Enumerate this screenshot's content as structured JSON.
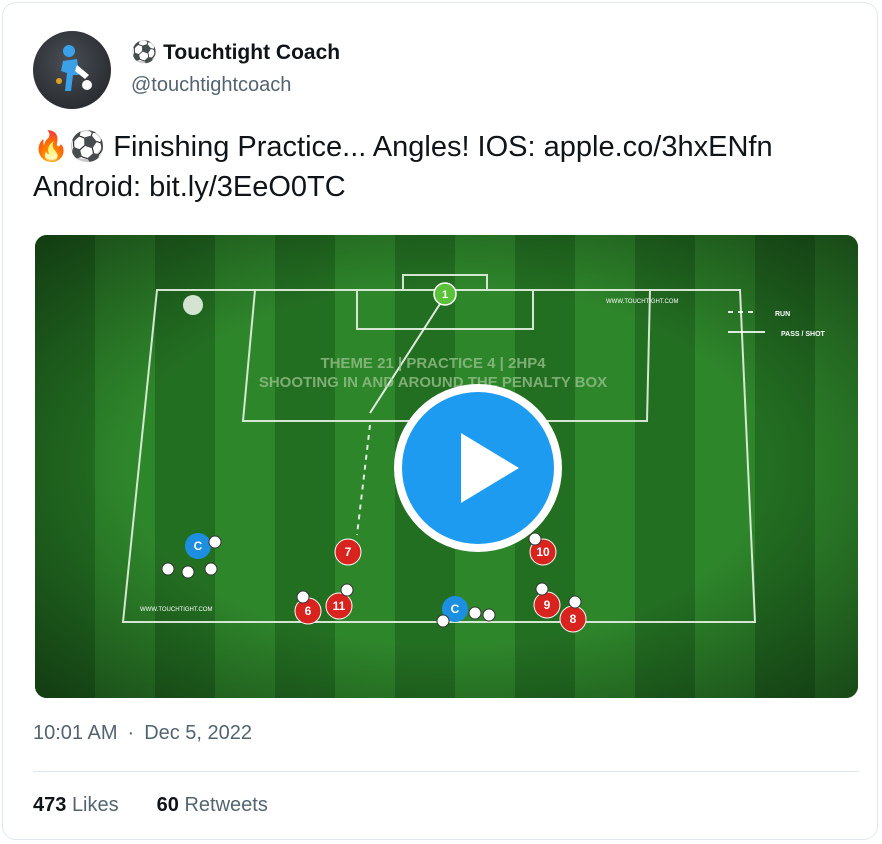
{
  "author": {
    "avatar_icon": "touchtight-logo-icon",
    "name_emoji": "⚽",
    "name": "Touchtight Coach",
    "handle": "@touchtightcoach"
  },
  "tweet": {
    "emoji_prefix": "🔥⚽",
    "text_part1": " Finishing Practice... Angles! IOS: ",
    "link_ios": "apple.co/3hxENfn",
    "text_part2": "Android: ",
    "link_android": "bit.ly/3EeO0TC"
  },
  "media": {
    "type": "video",
    "play_icon": "play-icon",
    "overlay_title_line1": "THEME 21 | PRACTICE 4 | 2HP4",
    "overlay_title_line2": "SHOOTING IN AND AROUND THE PENALTY BOX",
    "legend_run": "RUN",
    "legend_pass": "PASS / SHOT",
    "watermark_top": "WWW.TOUCHTIGHT.COM",
    "watermark_bottom": "WWW.TOUCHTIGHT.COM",
    "players": {
      "keeper": "1",
      "coach_left": "C",
      "coach_center": "C",
      "p7": "7",
      "p10": "10",
      "p6": "6",
      "p11": "11",
      "p9": "9",
      "p8": "8"
    },
    "colors": {
      "pitch_dark": "#1f6e1f",
      "pitch_light": "#2f8a2c",
      "red_player": "#d8231f",
      "blue_coach": "#1d8fe0",
      "keeper_green": "#5cc13a"
    }
  },
  "footer": {
    "time": "10:01 AM",
    "separator": "·",
    "date": "Dec 5, 2022"
  },
  "stats": {
    "likes_count": "473",
    "likes_label": "Likes",
    "retweets_count": "60",
    "retweets_label": "Retweets"
  },
  "colors": {
    "accent_blue": "#1d9bf0",
    "secondary_text": "#536471"
  }
}
